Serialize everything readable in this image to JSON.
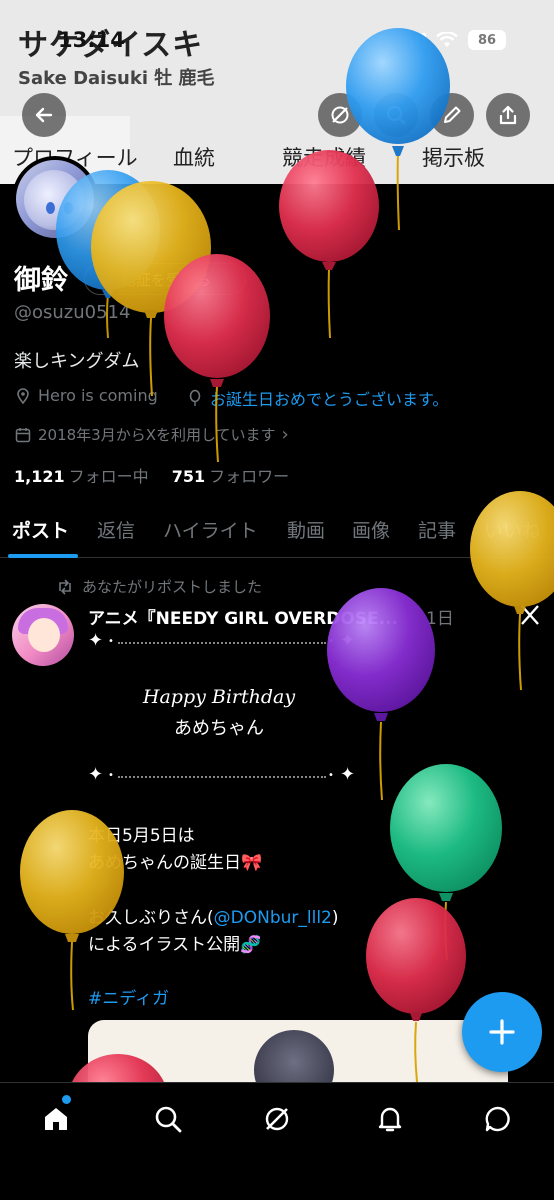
{
  "status_bar": {
    "time": "13:14",
    "battery": "86"
  },
  "header": {
    "name": "サケダイスキ",
    "subtitle": "Sake Daisuki 牡 鹿毛"
  },
  "top_tabs": [
    "プロフィール",
    "血統",
    "競走成績",
    "掲示板"
  ],
  "profile": {
    "display_name": "御鈴",
    "verify_label": "認証を受ける",
    "handle": "@osuzu0514",
    "bio": "楽しキングダム",
    "location": "Hero is coming",
    "website": "お誕生日おめでとうございます。",
    "joined": "2018年3月からXを利用しています",
    "following_count": "1,121",
    "following_label": "フォロー中",
    "followers_count": "751",
    "followers_label": "フォロワー"
  },
  "profile_tabs": [
    "ポスト",
    "返信",
    "ハイライト",
    "動画",
    "画像",
    "記事",
    "いいね"
  ],
  "post": {
    "repost_label": "あなたがリポストしました",
    "author": "アニメ『NEEDY GIRL OVERDOSE...",
    "time": "1日",
    "happy_line1": "Happy Birthday",
    "happy_line2": "あめちゃん",
    "line1": "本日5月5日は",
    "line2": "あめちゃんの誕生日🎀",
    "line3_prefix": "お久しぶりさん(",
    "mention": "@DONbur_lll2",
    "line3_suffix": ")",
    "line4": "によるイラスト公開🧬",
    "hashtag": "#ニディガ"
  },
  "fab_icon": "plus-icon",
  "bottom_nav": [
    "home-icon",
    "search-icon",
    "grok-icon",
    "bell-icon",
    "message-icon"
  ],
  "colors": {
    "accent": "#1d9bf0",
    "background": "#000000",
    "header_bg": "#e9e9ea",
    "balloon_red": "#e2304f",
    "balloon_yellow": "#e6b51e",
    "balloon_blue": "#2f9cf0",
    "balloon_purple": "#8a2fd6",
    "balloon_green": "#1fc48a"
  }
}
